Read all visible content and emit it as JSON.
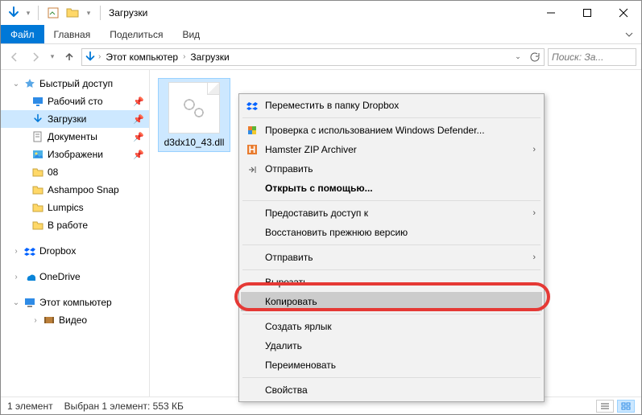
{
  "title": "Загрузки",
  "ribbon": {
    "file": "Файл",
    "home": "Главная",
    "share": "Поделиться",
    "view": "Вид"
  },
  "breadcrumb": {
    "root": "Этот компьютер",
    "current": "Загрузки"
  },
  "search": {
    "placeholder": "Поиск: За..."
  },
  "sidebar": {
    "quick_access": "Быстрый доступ",
    "items": [
      {
        "label": "Рабочий сто",
        "pin": true,
        "icon": "desktop"
      },
      {
        "label": "Загрузки",
        "pin": true,
        "icon": "downloads",
        "selected": true
      },
      {
        "label": "Документы",
        "pin": true,
        "icon": "documents"
      },
      {
        "label": "Изображени",
        "pin": true,
        "icon": "pictures"
      },
      {
        "label": "08",
        "pin": false,
        "icon": "folder"
      },
      {
        "label": "Ashampoo Snap",
        "pin": false,
        "icon": "folder"
      },
      {
        "label": "Lumpics",
        "pin": false,
        "icon": "folder"
      },
      {
        "label": "В работе",
        "pin": false,
        "icon": "folder"
      }
    ],
    "dropbox": "Dropbox",
    "onedrive": "OneDrive",
    "this_pc": "Этот компьютер",
    "videos": "Видео"
  },
  "file": {
    "name": "d3dx10_43.dll"
  },
  "context_menu": {
    "move_to_dropbox": "Переместить в папку Dropbox",
    "defender": "Проверка с использованием Windows Defender...",
    "hamster": "Hamster ZIP Archiver",
    "send_to_1": "Отправить",
    "open_with": "Открыть с помощью...",
    "grant_access": "Предоставить доступ к",
    "restore_previous": "Восстановить прежнюю версию",
    "send_to_2": "Отправить",
    "cut": "Вырезать",
    "copy": "Копировать",
    "create_shortcut": "Создать ярлык",
    "delete": "Удалить",
    "rename": "Переименовать",
    "properties": "Свойства"
  },
  "statusbar": {
    "count": "1 элемент",
    "selection": "Выбран 1 элемент: 553 КБ"
  }
}
